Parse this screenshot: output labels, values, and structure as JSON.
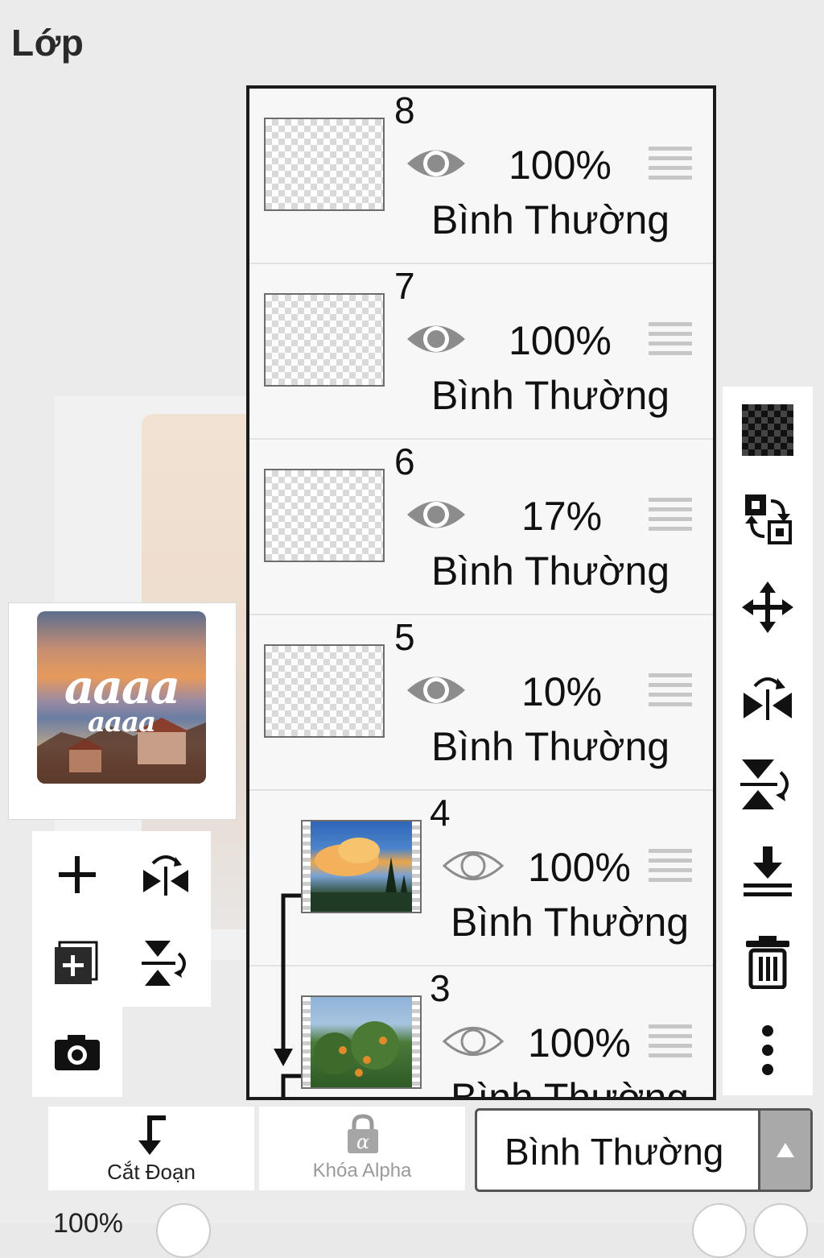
{
  "panel": {
    "title": "Lớp"
  },
  "preview": {
    "word1": "aaaa",
    "word2": "aaaa"
  },
  "layers": [
    {
      "number": "8",
      "opacity": "100%",
      "blend": "Bình Thường",
      "visible": true,
      "thumb": "transparent"
    },
    {
      "number": "7",
      "opacity": "100%",
      "blend": "Bình Thường",
      "visible": true,
      "thumb": "transparent"
    },
    {
      "number": "6",
      "opacity": "17%",
      "blend": "Bình Thường",
      "visible": true,
      "thumb": "transparent"
    },
    {
      "number": "5",
      "opacity": "10%",
      "blend": "Bình Thường",
      "visible": true,
      "thumb": "transparent"
    },
    {
      "number": "4",
      "opacity": "100%",
      "blend": "Bình Thường",
      "visible": false,
      "thumb": "sky-photo",
      "clipped": true
    },
    {
      "number": "3",
      "opacity": "100%",
      "blend": "Bình Thường",
      "visible": false,
      "thumb": "tree-photo",
      "clipped": true
    }
  ],
  "left_tools": [
    "add-layer-icon",
    "flip-horizontal-icon",
    "add-copy-layer-icon",
    "flip-vertical-icon",
    "camera-icon"
  ],
  "right_tools": [
    "transparency-icon",
    "swap-layers-icon",
    "move-icon",
    "flip-horizontal-icon",
    "flip-vertical-icon",
    "merge-down-icon",
    "trash-icon",
    "more-icon"
  ],
  "bottom": {
    "clip_label": "Cắt Đoạn",
    "alpha_label": "Khóa Alpha",
    "blend_select": "Bình Thường",
    "zoom_partial": "100%"
  },
  "colors": {
    "accent": "#1a1a1a",
    "grip": "#c6c6c6",
    "eye_visible": "#8c8c8c"
  }
}
